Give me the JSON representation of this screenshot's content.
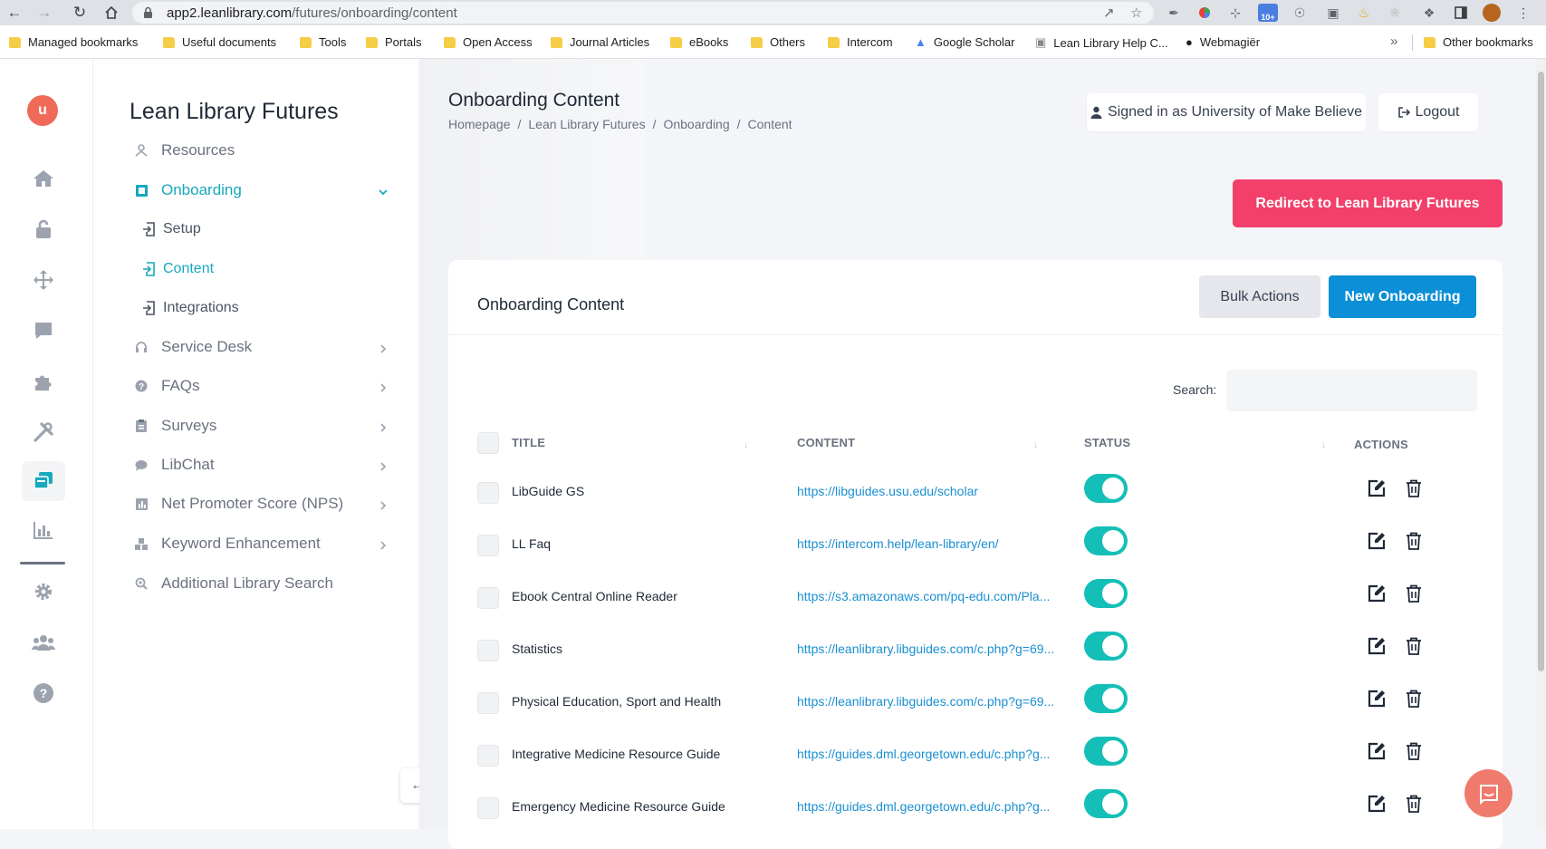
{
  "browser": {
    "url_host": "app2.leanlibrary.com",
    "url_path": "/futures/onboarding/content",
    "extension_badge": "10+",
    "bookmarks": [
      "Managed bookmarks",
      "Useful documents",
      "Tools",
      "Portals",
      "Open Access",
      "Journal Articles",
      "eBooks",
      "Others",
      "Intercom",
      "Google Scholar",
      "Lean Library Help C...",
      "Webmagiër"
    ],
    "other_bookmarks": "Other bookmarks"
  },
  "brand": {
    "logo_text": "u",
    "accent": "#17a9bd",
    "logo_color": "#f06a59"
  },
  "sidebar": {
    "title": "Lean Library Futures",
    "items": [
      {
        "label": "Resources"
      },
      {
        "label": "Onboarding"
      },
      {
        "label": "Service Desk"
      },
      {
        "label": "FAQs"
      },
      {
        "label": "Surveys"
      },
      {
        "label": "LibChat"
      },
      {
        "label": "Net Promoter Score (NPS)"
      },
      {
        "label": "Keyword Enhancement"
      },
      {
        "label": "Additional Library Search"
      }
    ],
    "sub_items": [
      {
        "label": "Setup"
      },
      {
        "label": "Content"
      },
      {
        "label": "Integrations"
      }
    ]
  },
  "header": {
    "title": "Onboarding Content",
    "breadcrumb": [
      "Homepage",
      "Lean Library Futures",
      "Onboarding",
      "Content"
    ],
    "breadcrumb_sep": "/",
    "signed_in": "Signed in as University of Make Believe",
    "logout": "Logout",
    "redirect_button": "Redirect to Lean Library Futures"
  },
  "card": {
    "title": "Onboarding Content",
    "bulk_actions": "Bulk Actions",
    "new_onboarding": "New Onboarding",
    "search_label": "Search:",
    "search_value": "",
    "columns": [
      "TITLE",
      "CONTENT",
      "STATUS",
      "ACTIONS"
    ],
    "rows": [
      {
        "title": "LibGuide GS",
        "content": "https://libguides.usu.edu/scholar",
        "status": "on"
      },
      {
        "title": "LL Faq",
        "content": "https://intercom.help/lean-library/en/",
        "status": "on"
      },
      {
        "title": "Ebook Central Online Reader",
        "content": "https://s3.amazonaws.com/pq-edu.com/Pla...",
        "status": "on"
      },
      {
        "title": "Statistics",
        "content": "https://leanlibrary.libguides.com/c.php?g=69...",
        "status": "on"
      },
      {
        "title": "Physical Education, Sport and Health",
        "content": "https://leanlibrary.libguides.com/c.php?g=69...",
        "status": "on"
      },
      {
        "title": "Integrative Medicine Resource Guide",
        "content": "https://guides.dml.georgetown.edu/c.php?g...",
        "status": "on"
      },
      {
        "title": "Emergency Medicine Resource Guide",
        "content": "https://guides.dml.georgetown.edu/c.php?g...",
        "status": "on"
      }
    ]
  },
  "colors": {
    "redirect": "#f2406a",
    "primary": "#0b8fd6",
    "toggle_on": "#13bfb6"
  }
}
